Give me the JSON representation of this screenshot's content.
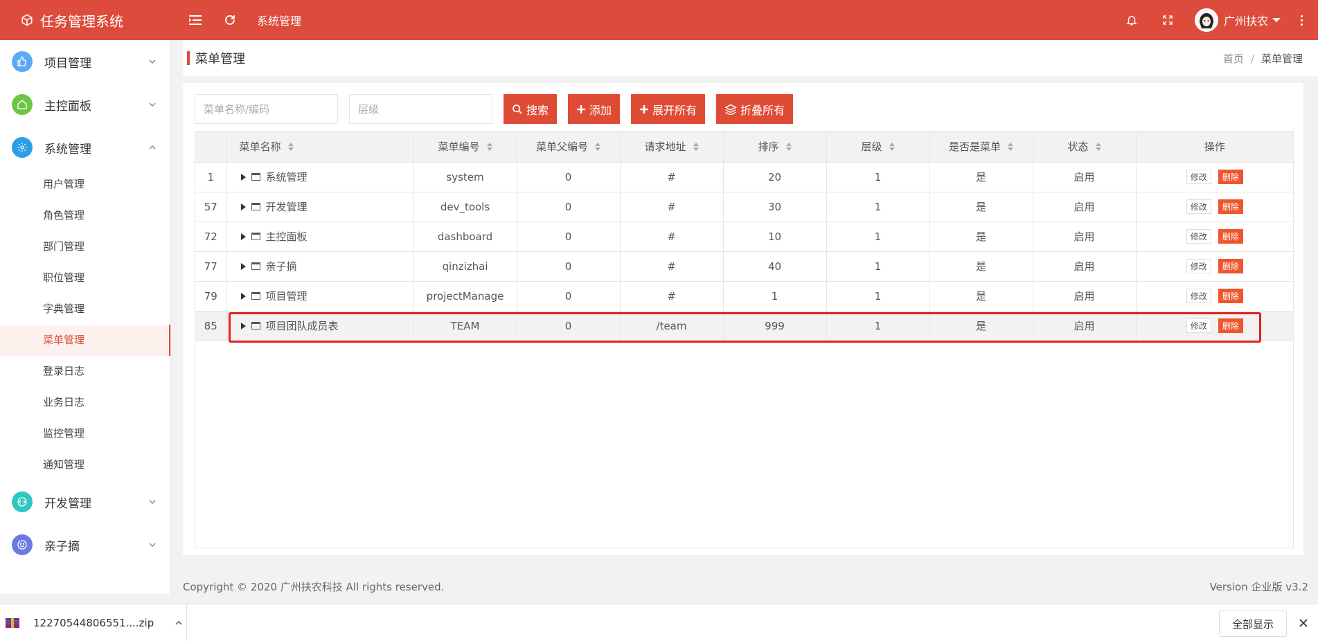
{
  "header": {
    "brand": "任务管理系统",
    "breadcrumb_title": "系统管理",
    "user_name": "广州扶农"
  },
  "sidebar": {
    "groups_top": [
      {
        "label": "项目管理",
        "icon": "thumbs-up-icon",
        "color": "#5aa9f5"
      },
      {
        "label": "主控面板",
        "icon": "home-icon",
        "color": "#6cc644"
      },
      {
        "label": "系统管理",
        "icon": "gear-icon",
        "color": "#2a9ee8"
      }
    ],
    "sub_items": [
      "用户管理",
      "角色管理",
      "部门管理",
      "职位管理",
      "字典管理",
      "菜单管理",
      "登录日志",
      "业务日志",
      "监控管理",
      "通知管理"
    ],
    "active_sub": "菜单管理",
    "groups_bottom": [
      {
        "label": "开发管理",
        "icon": "code-icon",
        "color": "#2fc7c0"
      },
      {
        "label": "亲子摘",
        "icon": "smile-icon",
        "color": "#6b79e0"
      }
    ]
  },
  "page": {
    "title": "菜单管理",
    "breadcrumb_home": "首页",
    "breadcrumb_sep": "/",
    "breadcrumb_current": "菜单管理"
  },
  "toolbar": {
    "search_placeholder": "菜单名称/编码",
    "level_placeholder": "层级",
    "search_label": "搜索",
    "add_label": "添加",
    "expand_label": "展开所有",
    "collapse_label": "折叠所有"
  },
  "table": {
    "columns": [
      "菜单名称",
      "菜单编号",
      "菜单父编号",
      "请求地址",
      "排序",
      "层级",
      "是否是菜单",
      "状态",
      "操作"
    ],
    "edit_label": "修改",
    "delete_label": "删除",
    "rows": [
      {
        "id": "1",
        "name": "系统管理",
        "code": "system",
        "parent": "0",
        "url": "#",
        "sort": "20",
        "level": "1",
        "is_menu": "是",
        "status": "启用"
      },
      {
        "id": "57",
        "name": "开发管理",
        "code": "dev_tools",
        "parent": "0",
        "url": "#",
        "sort": "30",
        "level": "1",
        "is_menu": "是",
        "status": "启用"
      },
      {
        "id": "72",
        "name": "主控面板",
        "code": "dashboard",
        "parent": "0",
        "url": "#",
        "sort": "10",
        "level": "1",
        "is_menu": "是",
        "status": "启用"
      },
      {
        "id": "77",
        "name": "亲子摘",
        "code": "qinzizhai",
        "parent": "0",
        "url": "#",
        "sort": "40",
        "level": "1",
        "is_menu": "是",
        "status": "启用"
      },
      {
        "id": "79",
        "name": "项目管理",
        "code": "projectManage",
        "parent": "0",
        "url": "#",
        "sort": "1",
        "level": "1",
        "is_menu": "是",
        "status": "启用"
      },
      {
        "id": "85",
        "name": "项目团队成员表",
        "code": "TEAM",
        "parent": "0",
        "url": "/team",
        "sort": "999",
        "level": "1",
        "is_menu": "是",
        "status": "启用"
      }
    ]
  },
  "footer": {
    "copyright": "Copyright © 2020 广州扶农科技 All rights reserved.",
    "version": "Version 企业版 v3.2"
  },
  "download": {
    "file_name": "12270544806551....zip",
    "show_all": "全部显示"
  },
  "colors": {
    "brand_red": "#dc4b3b",
    "button_red": "#e04b36",
    "highlight_box": "#e02020"
  }
}
